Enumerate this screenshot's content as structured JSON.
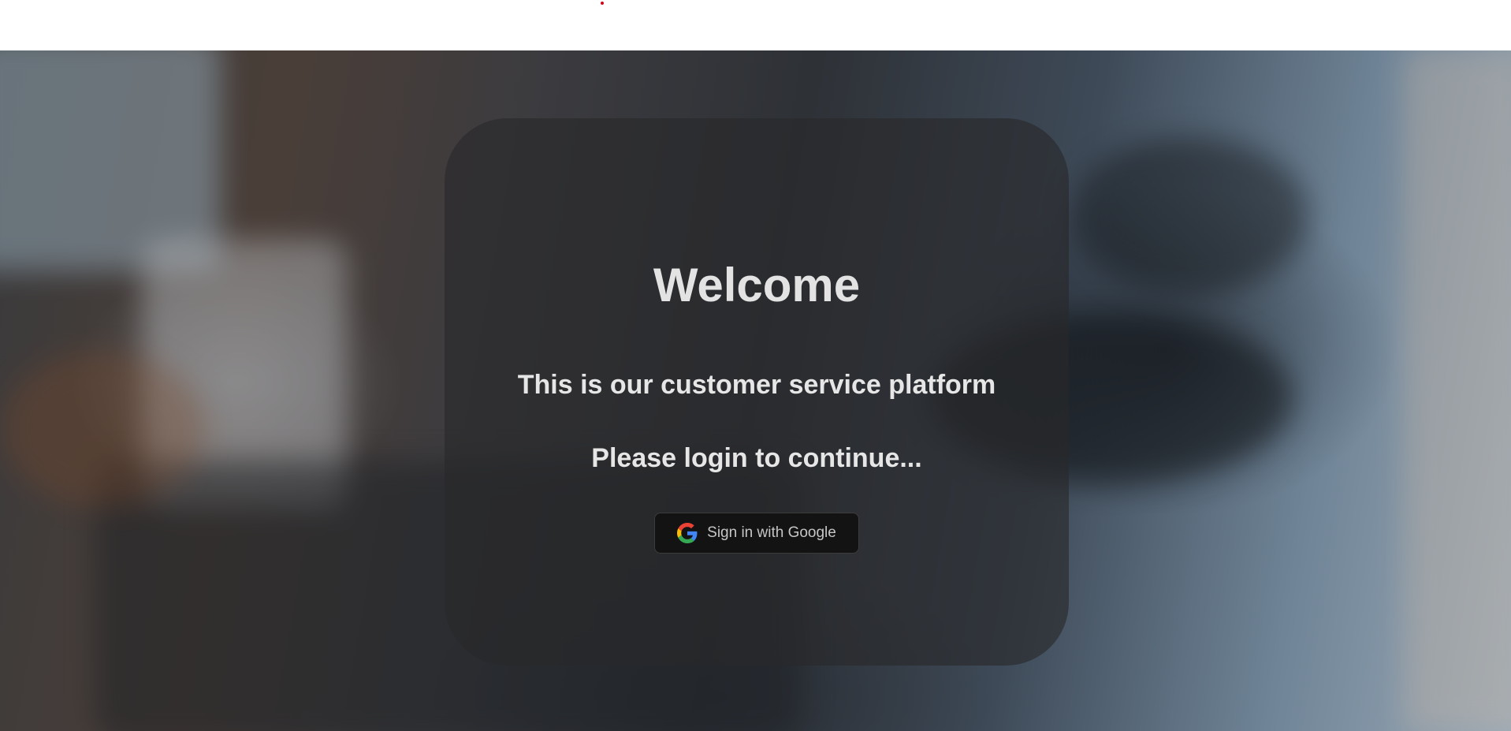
{
  "card": {
    "title": "Welcome",
    "subtitle": "This is our customer service platform",
    "prompt": "Please login to continue...",
    "signin_button": {
      "label": "Sign in with Google",
      "icon": "google-icon"
    }
  },
  "colors": {
    "card_background": "#28282a",
    "button_background": "#131314",
    "text": "#e6e6e6",
    "accent_dot": "#d0021b"
  }
}
